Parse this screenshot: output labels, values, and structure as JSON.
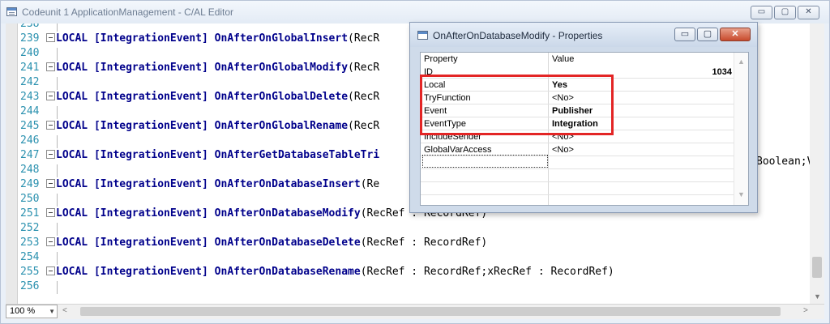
{
  "window": {
    "title": "Codeunit 1 ApplicationManagement - C/AL Editor",
    "controls": [
      "▭",
      "▢",
      "✕"
    ]
  },
  "code": {
    "lines": [
      {
        "num": "238",
        "text": ""
      },
      {
        "num": "239",
        "kw": "LOCAL [IntegrationEvent] ",
        "fn": "OnAfterOnGlobalInsert",
        "rest": "(RecR"
      },
      {
        "num": "240",
        "text": ""
      },
      {
        "num": "241",
        "kw": "LOCAL [IntegrationEvent] ",
        "fn": "OnAfterOnGlobalModify",
        "rest": "(RecR"
      },
      {
        "num": "242",
        "text": ""
      },
      {
        "num": "243",
        "kw": "LOCAL [IntegrationEvent] ",
        "fn": "OnAfterOnGlobalDelete",
        "rest": "(RecR"
      },
      {
        "num": "244",
        "text": ""
      },
      {
        "num": "245",
        "kw": "LOCAL [IntegrationEvent] ",
        "fn": "OnAfterOnGlobalRename",
        "rest": "(RecR"
      },
      {
        "num": "246",
        "text": ""
      },
      {
        "num": "247",
        "kw": "LOCAL [IntegrationEvent] ",
        "fn": "OnAfterGetDatabaseTableTri",
        "rest": ""
      },
      {
        "num": "248",
        "text": ""
      },
      {
        "num": "249",
        "kw": "LOCAL [IntegrationEvent] ",
        "fn": "OnAfterOnDatabaseInsert",
        "rest": "(Re"
      },
      {
        "num": "250",
        "text": ""
      },
      {
        "num": "251",
        "kw": "LOCAL [IntegrationEvent] ",
        "fn": "OnAfterOnDatabaseModify",
        "rest": "(RecRef : RecordRef)"
      },
      {
        "num": "252",
        "text": ""
      },
      {
        "num": "253",
        "kw": "LOCAL [IntegrationEvent] ",
        "fn": "OnAfterOnDatabaseDelete",
        "rest": "(RecRef : RecordRef)"
      },
      {
        "num": "254",
        "text": ""
      },
      {
        "num": "255",
        "kw": "LOCAL [IntegrationEvent] ",
        "fn": "OnAfterOnDatabaseRename",
        "rest": "(RecRef : RecordRef;xRecRef : RecordRef)"
      },
      {
        "num": "256",
        "text": ""
      }
    ],
    "line247_tail": "Boolean;V"
  },
  "status": {
    "zoom": "100 %"
  },
  "dialog": {
    "title": "OnAfterOnDatabaseModify - Properties",
    "columns": {
      "property": "Property",
      "value": "Value"
    },
    "rows": [
      {
        "property": "ID",
        "value": "1034"
      },
      {
        "property": "Local",
        "value": "Yes"
      },
      {
        "property": "TryFunction",
        "value": "<No>"
      },
      {
        "property": "Event",
        "value": "Publisher"
      },
      {
        "property": "EventType",
        "value": "Integration"
      },
      {
        "property": "IncludeSender",
        "value": "<No>"
      },
      {
        "property": "GlobalVarAccess",
        "value": "<No>"
      }
    ],
    "highlight_color": "#e32525"
  }
}
